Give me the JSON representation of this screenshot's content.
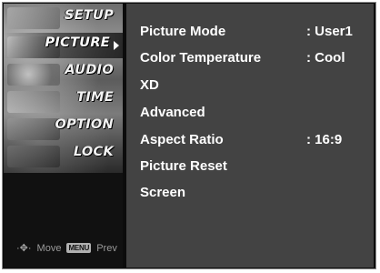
{
  "sidebar": {
    "items": [
      {
        "label": "SETUP"
      },
      {
        "label": "PICTURE"
      },
      {
        "label": "AUDIO"
      },
      {
        "label": "TIME"
      },
      {
        "label": "OPTION"
      },
      {
        "label": "LOCK"
      }
    ],
    "active": "PICTURE",
    "hint": {
      "move_icon": "move-icon",
      "move_label": "Move",
      "menu_key": "MENU",
      "prev_label": "Prev"
    }
  },
  "main": {
    "rows": [
      {
        "label": "Picture Mode",
        "value": ": User1"
      },
      {
        "label": "Color Temperature",
        "value": ": Cool"
      },
      {
        "label": "XD",
        "value": ""
      },
      {
        "label": "Advanced",
        "value": ""
      },
      {
        "label": "Aspect Ratio",
        "value": ": 16:9"
      },
      {
        "label": "Picture Reset",
        "value": ""
      },
      {
        "label": "Screen",
        "value": ""
      }
    ]
  },
  "colors": {
    "panel_bg": "#434343",
    "sidebar_bg": "#111111",
    "text": "#ffffff",
    "hint": "#9a9a9a"
  }
}
